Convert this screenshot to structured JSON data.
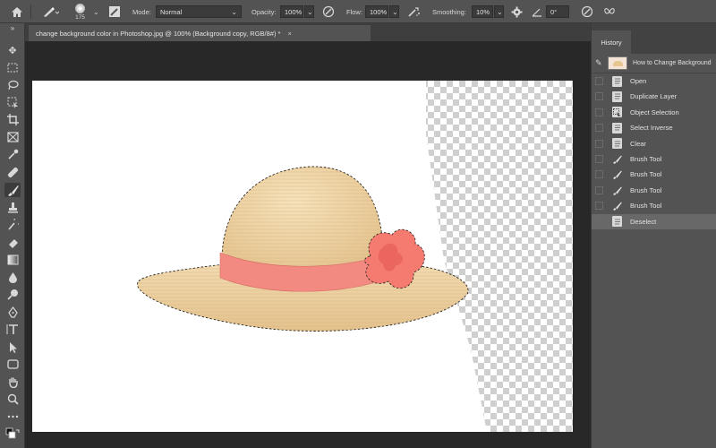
{
  "options_bar": {
    "brush_size": "175",
    "mode_label": "Mode:",
    "mode_value": "Normal",
    "opacity_label": "Opacity:",
    "opacity_value": "100%",
    "flow_label": "Flow:",
    "flow_value": "100%",
    "smoothing_label": "Smoothing:",
    "smoothing_value": "10%",
    "angle_value": "0°"
  },
  "document_tab": {
    "title": "change background color in Photoshop.jpg @ 100% (Background copy, RGB/8#) *",
    "close": "×"
  },
  "history": {
    "panel_title": "History",
    "snapshot_name": "How to Change Background",
    "items": [
      {
        "label": "Open",
        "icon": "document-icon"
      },
      {
        "label": "Duplicate Layer",
        "icon": "document-icon"
      },
      {
        "label": "Object Selection",
        "icon": "object-selection-icon"
      },
      {
        "label": "Select Inverse",
        "icon": "document-icon"
      },
      {
        "label": "Clear",
        "icon": "document-icon"
      },
      {
        "label": "Brush Tool",
        "icon": "brush-icon"
      },
      {
        "label": "Brush Tool",
        "icon": "brush-icon"
      },
      {
        "label": "Brush Tool",
        "icon": "brush-icon"
      },
      {
        "label": "Brush Tool",
        "icon": "brush-icon"
      },
      {
        "label": "Deselect",
        "icon": "document-icon"
      }
    ],
    "selected_index": 9
  },
  "colors": {
    "ui_bg": "#535353",
    "pasteboard": "#282828",
    "hat_straw": "#e9cc9a",
    "hat_band": "#f08a80"
  }
}
